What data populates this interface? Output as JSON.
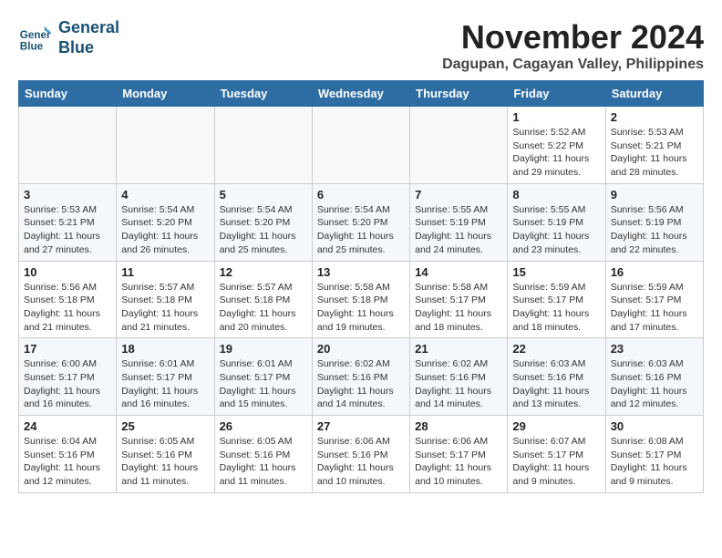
{
  "logo": {
    "text_line1": "General",
    "text_line2": "Blue"
  },
  "title": "November 2024",
  "subtitle": "Dagupan, Cagayan Valley, Philippines",
  "weekdays": [
    "Sunday",
    "Monday",
    "Tuesday",
    "Wednesday",
    "Thursday",
    "Friday",
    "Saturday"
  ],
  "weeks": [
    [
      {
        "day": "",
        "sunrise": "",
        "sunset": "",
        "daylight": ""
      },
      {
        "day": "",
        "sunrise": "",
        "sunset": "",
        "daylight": ""
      },
      {
        "day": "",
        "sunrise": "",
        "sunset": "",
        "daylight": ""
      },
      {
        "day": "",
        "sunrise": "",
        "sunset": "",
        "daylight": ""
      },
      {
        "day": "",
        "sunrise": "",
        "sunset": "",
        "daylight": ""
      },
      {
        "day": "1",
        "sunrise": "Sunrise: 5:52 AM",
        "sunset": "Sunset: 5:22 PM",
        "daylight": "Daylight: 11 hours and 29 minutes."
      },
      {
        "day": "2",
        "sunrise": "Sunrise: 5:53 AM",
        "sunset": "Sunset: 5:21 PM",
        "daylight": "Daylight: 11 hours and 28 minutes."
      }
    ],
    [
      {
        "day": "3",
        "sunrise": "Sunrise: 5:53 AM",
        "sunset": "Sunset: 5:21 PM",
        "daylight": "Daylight: 11 hours and 27 minutes."
      },
      {
        "day": "4",
        "sunrise": "Sunrise: 5:54 AM",
        "sunset": "Sunset: 5:20 PM",
        "daylight": "Daylight: 11 hours and 26 minutes."
      },
      {
        "day": "5",
        "sunrise": "Sunrise: 5:54 AM",
        "sunset": "Sunset: 5:20 PM",
        "daylight": "Daylight: 11 hours and 25 minutes."
      },
      {
        "day": "6",
        "sunrise": "Sunrise: 5:54 AM",
        "sunset": "Sunset: 5:20 PM",
        "daylight": "Daylight: 11 hours and 25 minutes."
      },
      {
        "day": "7",
        "sunrise": "Sunrise: 5:55 AM",
        "sunset": "Sunset: 5:19 PM",
        "daylight": "Daylight: 11 hours and 24 minutes."
      },
      {
        "day": "8",
        "sunrise": "Sunrise: 5:55 AM",
        "sunset": "Sunset: 5:19 PM",
        "daylight": "Daylight: 11 hours and 23 minutes."
      },
      {
        "day": "9",
        "sunrise": "Sunrise: 5:56 AM",
        "sunset": "Sunset: 5:19 PM",
        "daylight": "Daylight: 11 hours and 22 minutes."
      }
    ],
    [
      {
        "day": "10",
        "sunrise": "Sunrise: 5:56 AM",
        "sunset": "Sunset: 5:18 PM",
        "daylight": "Daylight: 11 hours and 21 minutes."
      },
      {
        "day": "11",
        "sunrise": "Sunrise: 5:57 AM",
        "sunset": "Sunset: 5:18 PM",
        "daylight": "Daylight: 11 hours and 21 minutes."
      },
      {
        "day": "12",
        "sunrise": "Sunrise: 5:57 AM",
        "sunset": "Sunset: 5:18 PM",
        "daylight": "Daylight: 11 hours and 20 minutes."
      },
      {
        "day": "13",
        "sunrise": "Sunrise: 5:58 AM",
        "sunset": "Sunset: 5:18 PM",
        "daylight": "Daylight: 11 hours and 19 minutes."
      },
      {
        "day": "14",
        "sunrise": "Sunrise: 5:58 AM",
        "sunset": "Sunset: 5:17 PM",
        "daylight": "Daylight: 11 hours and 18 minutes."
      },
      {
        "day": "15",
        "sunrise": "Sunrise: 5:59 AM",
        "sunset": "Sunset: 5:17 PM",
        "daylight": "Daylight: 11 hours and 18 minutes."
      },
      {
        "day": "16",
        "sunrise": "Sunrise: 5:59 AM",
        "sunset": "Sunset: 5:17 PM",
        "daylight": "Daylight: 11 hours and 17 minutes."
      }
    ],
    [
      {
        "day": "17",
        "sunrise": "Sunrise: 6:00 AM",
        "sunset": "Sunset: 5:17 PM",
        "daylight": "Daylight: 11 hours and 16 minutes."
      },
      {
        "day": "18",
        "sunrise": "Sunrise: 6:01 AM",
        "sunset": "Sunset: 5:17 PM",
        "daylight": "Daylight: 11 hours and 16 minutes."
      },
      {
        "day": "19",
        "sunrise": "Sunrise: 6:01 AM",
        "sunset": "Sunset: 5:17 PM",
        "daylight": "Daylight: 11 hours and 15 minutes."
      },
      {
        "day": "20",
        "sunrise": "Sunrise: 6:02 AM",
        "sunset": "Sunset: 5:16 PM",
        "daylight": "Daylight: 11 hours and 14 minutes."
      },
      {
        "day": "21",
        "sunrise": "Sunrise: 6:02 AM",
        "sunset": "Sunset: 5:16 PM",
        "daylight": "Daylight: 11 hours and 14 minutes."
      },
      {
        "day": "22",
        "sunrise": "Sunrise: 6:03 AM",
        "sunset": "Sunset: 5:16 PM",
        "daylight": "Daylight: 11 hours and 13 minutes."
      },
      {
        "day": "23",
        "sunrise": "Sunrise: 6:03 AM",
        "sunset": "Sunset: 5:16 PM",
        "daylight": "Daylight: 11 hours and 12 minutes."
      }
    ],
    [
      {
        "day": "24",
        "sunrise": "Sunrise: 6:04 AM",
        "sunset": "Sunset: 5:16 PM",
        "daylight": "Daylight: 11 hours and 12 minutes."
      },
      {
        "day": "25",
        "sunrise": "Sunrise: 6:05 AM",
        "sunset": "Sunset: 5:16 PM",
        "daylight": "Daylight: 11 hours and 11 minutes."
      },
      {
        "day": "26",
        "sunrise": "Sunrise: 6:05 AM",
        "sunset": "Sunset: 5:16 PM",
        "daylight": "Daylight: 11 hours and 11 minutes."
      },
      {
        "day": "27",
        "sunrise": "Sunrise: 6:06 AM",
        "sunset": "Sunset: 5:16 PM",
        "daylight": "Daylight: 11 hours and 10 minutes."
      },
      {
        "day": "28",
        "sunrise": "Sunrise: 6:06 AM",
        "sunset": "Sunset: 5:17 PM",
        "daylight": "Daylight: 11 hours and 10 minutes."
      },
      {
        "day": "29",
        "sunrise": "Sunrise: 6:07 AM",
        "sunset": "Sunset: 5:17 PM",
        "daylight": "Daylight: 11 hours and 9 minutes."
      },
      {
        "day": "30",
        "sunrise": "Sunrise: 6:08 AM",
        "sunset": "Sunset: 5:17 PM",
        "daylight": "Daylight: 11 hours and 9 minutes."
      }
    ]
  ]
}
